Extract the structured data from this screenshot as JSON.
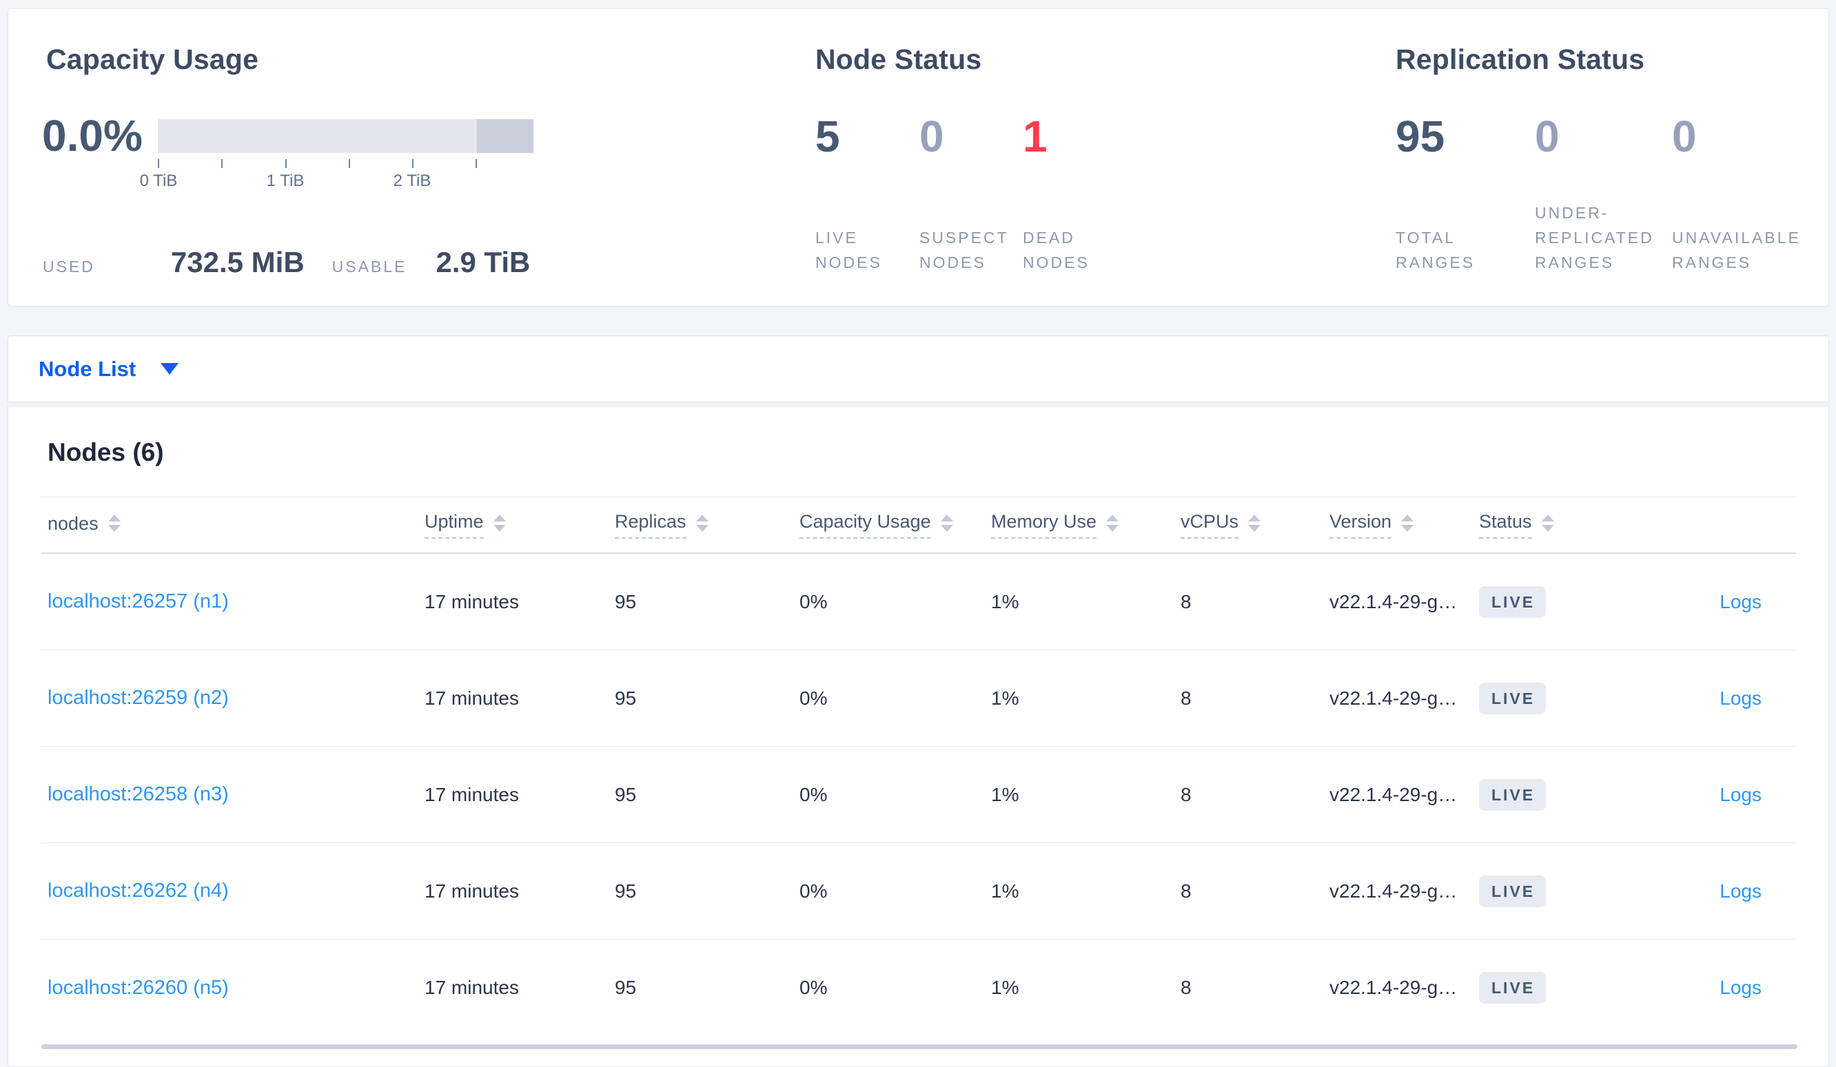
{
  "colors": {
    "page_background": "#f3f5f9",
    "card_background": "#ffffff",
    "accent_blue": "#0d5ef5",
    "link_blue": "#2e96f5",
    "strong_number": "#475872",
    "muted_number": "#98a1ba",
    "danger_red": "#ff3b4f",
    "label_gray": "#8e98ad",
    "gauge_bar": "#e4e6ef",
    "gauge_bar_reserved": "#cacfdc",
    "badge_background": "#e7ebf2"
  },
  "summary": {
    "capacity": {
      "title": "Capacity Usage",
      "percent_used": "0.0%",
      "used_label": "USED",
      "used_value": "732.5 MiB",
      "usable_label": "USABLE",
      "usable_value": "2.9 TiB",
      "gauge": {
        "tick_labels": [
          "0 TiB",
          "1 TiB",
          "2 TiB"
        ],
        "tick_count": 6,
        "tick_step_tib": 0.5,
        "used_fraction": 0.0
      }
    },
    "node_status": {
      "title": "Node Status",
      "stats": [
        {
          "value": "5",
          "label": "LIVE NODES",
          "tone": "strong"
        },
        {
          "value": "0",
          "label": "SUSPECT NODES",
          "tone": "muted"
        },
        {
          "value": "1",
          "label": "DEAD NODES",
          "tone": "danger"
        }
      ]
    },
    "replication_status": {
      "title": "Replication Status",
      "stats": [
        {
          "value": "95",
          "label": "TOTAL RANGES",
          "tone": "strong"
        },
        {
          "value": "0",
          "label": "UNDER-REPLICATED RANGES",
          "tone": "muted"
        },
        {
          "value": "0",
          "label": "UNAVAILABLE RANGES",
          "tone": "muted"
        }
      ]
    }
  },
  "view_selector": {
    "label": "Node List"
  },
  "nodes_table": {
    "title": "Nodes (6)",
    "columns": [
      {
        "label": "nodes"
      },
      {
        "label": "Uptime"
      },
      {
        "label": "Replicas"
      },
      {
        "label": "Capacity Usage"
      },
      {
        "label": "Memory Use"
      },
      {
        "label": "vCPUs"
      },
      {
        "label": "Version"
      },
      {
        "label": "Status"
      }
    ],
    "rows": [
      {
        "node": "localhost:26257 (n1)",
        "uptime": "17 minutes",
        "replicas": "95",
        "capacity": "0%",
        "memory": "1%",
        "vcpus": "8",
        "version": "v22.1.4-29-g…",
        "status": "LIVE",
        "logs": "Logs"
      },
      {
        "node": "localhost:26259 (n2)",
        "uptime": "17 minutes",
        "replicas": "95",
        "capacity": "0%",
        "memory": "1%",
        "vcpus": "8",
        "version": "v22.1.4-29-g…",
        "status": "LIVE",
        "logs": "Logs"
      },
      {
        "node": "localhost:26258 (n3)",
        "uptime": "17 minutes",
        "replicas": "95",
        "capacity": "0%",
        "memory": "1%",
        "vcpus": "8",
        "version": "v22.1.4-29-g…",
        "status": "LIVE",
        "logs": "Logs"
      },
      {
        "node": "localhost:26262 (n4)",
        "uptime": "17 minutes",
        "replicas": "95",
        "capacity": "0%",
        "memory": "1%",
        "vcpus": "8",
        "version": "v22.1.4-29-g…",
        "status": "LIVE",
        "logs": "Logs"
      },
      {
        "node": "localhost:26260 (n5)",
        "uptime": "17 minutes",
        "replicas": "95",
        "capacity": "0%",
        "memory": "1%",
        "vcpus": "8",
        "version": "v22.1.4-29-g…",
        "status": "LIVE",
        "logs": "Logs"
      }
    ]
  }
}
